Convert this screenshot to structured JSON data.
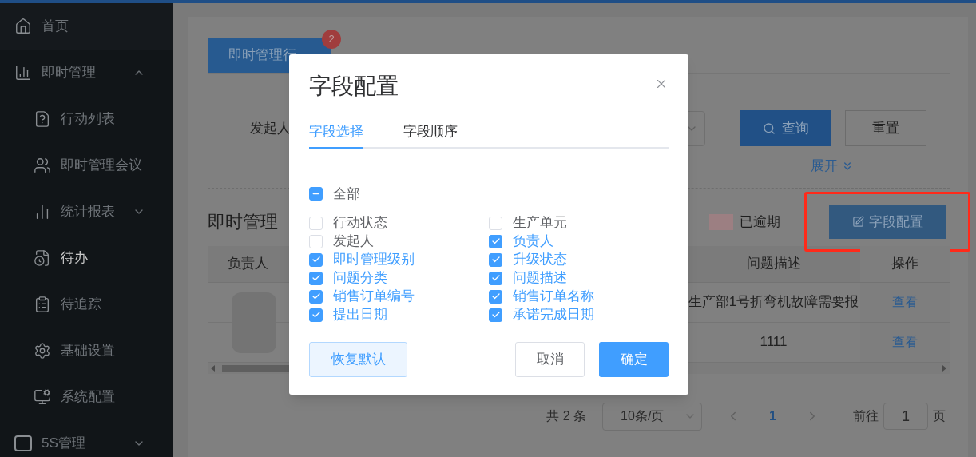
{
  "sidebar": {
    "items": [
      {
        "label": "首页",
        "selected": false
      },
      {
        "label": "即时管理",
        "selected": false,
        "expanded": true,
        "children": [
          {
            "label": "行动列表",
            "selected": false
          },
          {
            "label": "即时管理会议",
            "selected": false
          },
          {
            "label": "统计报表",
            "selected": false,
            "expanded": false
          },
          {
            "label": "待办",
            "selected": true
          },
          {
            "label": "待追踪",
            "selected": false
          },
          {
            "label": "基础设置",
            "selected": false
          },
          {
            "label": "系统配置",
            "selected": false
          }
        ]
      },
      {
        "label": "5S管理",
        "selected": false,
        "expanded": false
      }
    ]
  },
  "tabs": [
    {
      "label": "即时管理行",
      "selected": true,
      "badge": "2"
    }
  ],
  "filter": {
    "label": "发起人",
    "search_button": "查询",
    "reset_button": "重置",
    "expand_link": "展开"
  },
  "list": {
    "title": "即时管理",
    "legend": [
      {
        "label": "已逾期",
        "color": "#9c7f82"
      }
    ],
    "config_button": "字段配置",
    "highlighted": true
  },
  "table": {
    "columns": [
      "负责人",
      "问题描述",
      "操作"
    ],
    "rows": [
      {
        "description": "生产部1号折弯机故障需要报",
        "action": "查看"
      },
      {
        "description": "1111",
        "action": "查看"
      }
    ]
  },
  "pagination": {
    "total": "共 2 条",
    "page_size": "10条/页",
    "pages": [
      {
        "label": "1",
        "selected": true
      }
    ],
    "goto_label": "前往",
    "goto_value": "1",
    "goto_suffix": "页"
  },
  "dialog": {
    "title": "字段配置",
    "tabs": [
      {
        "label": "字段选择",
        "selected": true
      },
      {
        "label": "字段顺序",
        "selected": false
      }
    ],
    "select_all": {
      "label": "全部",
      "indeterminate": true
    },
    "fields": [
      {
        "label": "行动状态",
        "checked": false
      },
      {
        "label": "生产单元",
        "checked": false
      },
      {
        "label": "发起人",
        "checked": false
      },
      {
        "label": "负责人",
        "checked": true
      },
      {
        "label": "即时管理级别",
        "checked": true
      },
      {
        "label": "升级状态",
        "checked": true
      },
      {
        "label": "问题分类",
        "checked": true
      },
      {
        "label": "问题描述",
        "checked": true
      },
      {
        "label": "销售订单编号",
        "checked": true
      },
      {
        "label": "销售订单名称",
        "checked": true
      },
      {
        "label": "提出日期",
        "checked": true
      },
      {
        "label": "承诺完成日期",
        "checked": true
      }
    ],
    "buttons": {
      "restore": "恢复默认",
      "cancel": "取消",
      "confirm": "确定"
    }
  }
}
